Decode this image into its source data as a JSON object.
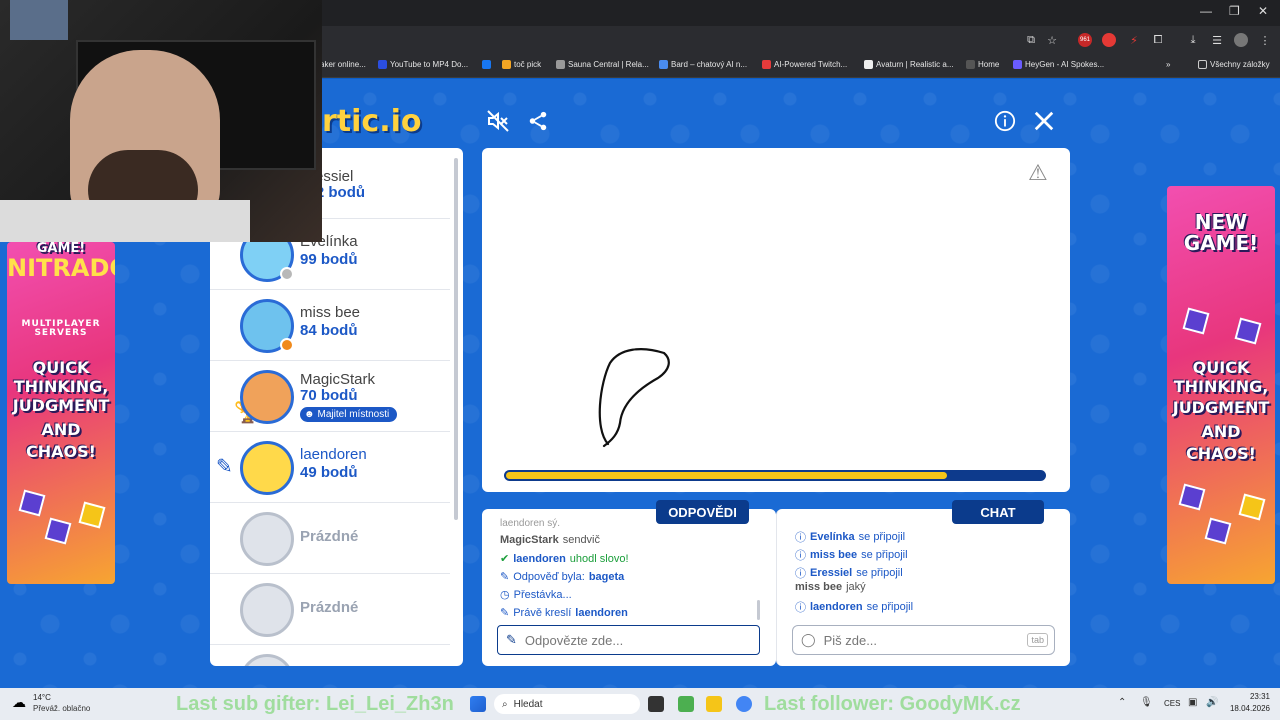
{
  "browser": {
    "bookmarks": [
      {
        "label": "aker online...",
        "color": "#e2483f"
      },
      {
        "label": "YouTube to MP4 Do...",
        "color": "#2b4ee0"
      },
      {
        "label": "",
        "color": "#1877f2"
      },
      {
        "label": "toč pick",
        "color": "#f5a623"
      },
      {
        "label": "Sauna Central | Rela...",
        "color": "#999999"
      },
      {
        "label": "Bard – chatový AI n...",
        "color": "#4a8cf0"
      },
      {
        "label": "AI-Powered Twitch...",
        "color": "#e63b3b"
      },
      {
        "label": "Avaturn | Realistic a...",
        "color": "#eeeeee"
      },
      {
        "label": "Home",
        "color": "#333333"
      },
      {
        "label": "HeyGen - AI Spokes...",
        "color": "#6a5cff"
      }
    ],
    "all_bookmarks": "Všechny záložky",
    "ext_badge": "961"
  },
  "game": {
    "logo": "rtic.io",
    "players": [
      {
        "name": "Eressiel",
        "points": "112 bodů",
        "avatar_color": "#5fc3f0",
        "status": ""
      },
      {
        "name": "Evelínka",
        "points": "99 bodů",
        "avatar_color": "#7fd0f5",
        "status": "#b8b8b8"
      },
      {
        "name": "miss bee",
        "points": "84 bodů",
        "avatar_color": "#6ec2ee",
        "status": "#f08a1c"
      },
      {
        "name": "MagicStark",
        "points": "70 bodů",
        "avatar_color": "#f0a25a",
        "status": "",
        "badge": "Majitel místnosti"
      },
      {
        "name": "laendoren",
        "points": "49 bodů",
        "avatar_color": "#ffd94a",
        "status": "",
        "drawing": true
      },
      {
        "name": "Prázdné",
        "points": "",
        "avatar_color": "#dfe3ea",
        "status": ""
      },
      {
        "name": "Prázdné",
        "points": "",
        "avatar_color": "#dfe3ea",
        "status": ""
      }
    ],
    "progress": 0.82,
    "answers_tab": "ODPOVĚDI",
    "chat_tab": "CHAT",
    "answers": {
      "cut_top": "laendoren sý.",
      "msg1_name": "MagicStark",
      "msg1_text": "sendvič",
      "msg2_name": "laendoren",
      "msg2_text": "uhodl slovo!",
      "msg3_text": "Odpověď byla:",
      "msg3_word": "bageta",
      "msg4_text": "Přestávka...",
      "msg5_text": "Právě kreslí",
      "msg5_name": "laendoren",
      "placeholder": "Odpovězte zde..."
    },
    "chat": {
      "lines": [
        {
          "name": "Evelínka",
          "text": "se připojil"
        },
        {
          "name": "miss bee",
          "text": "se připojil"
        },
        {
          "name": "Eressiel",
          "text": "se připojil"
        }
      ],
      "plain_name": "miss bee",
      "plain_text": "jaký",
      "last_name": "laendoren",
      "last_text": "se připojil",
      "placeholder": "Piš zde...",
      "tab_hint": "tab"
    }
  },
  "ads": {
    "left_top": "GAME!",
    "left_brand": "NITRADO",
    "left_sub": "MULTIPLAYER SERVERS",
    "right_top": "NEW GAME!",
    "slogan": [
      "QUICK",
      "THINKING,",
      "JUDGMENT",
      "AND",
      "CHAOS!"
    ]
  },
  "stream_overlay": {
    "last_sub": "Last sub gifter: Lei_Lei_Zh3n",
    "last_follower": "Last follower: GoodyMK.cz"
  },
  "taskbar": {
    "temp": "14°C",
    "weather": "Převáž. oblačno",
    "search": "Hledat",
    "lang": "CES",
    "time": "23:31",
    "date": "18.04.2026"
  }
}
